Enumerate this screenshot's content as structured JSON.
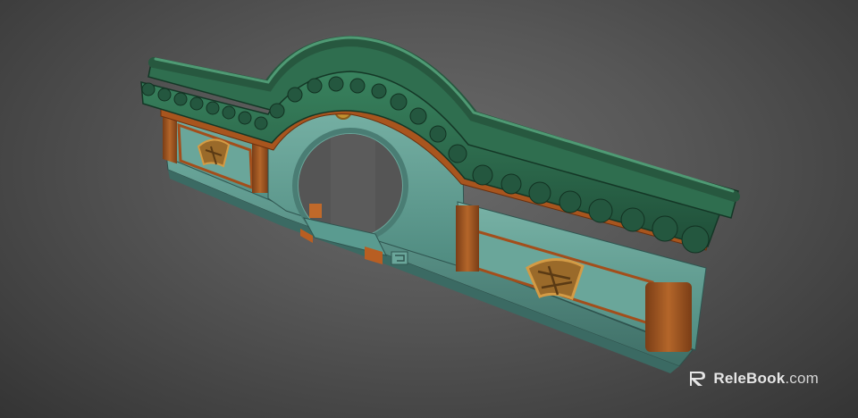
{
  "viewer": {
    "background_color": "#4e4e4e",
    "subject": "chinese-garden-moon-gate-wall-3d-model"
  },
  "model": {
    "roof_tile_color": "#2f6e4f",
    "wall_color": "#5f9e92",
    "timber_color": "#a8551e",
    "ornament_color": "#b8842e"
  },
  "watermark": {
    "brand": "ReleBook",
    "domain": ".com"
  }
}
